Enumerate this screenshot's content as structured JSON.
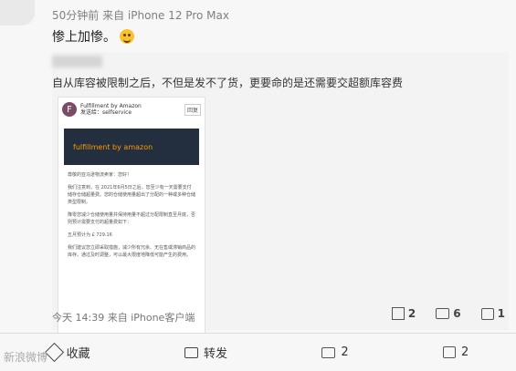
{
  "post_meta": "50分钟前 来自 iPhone 12 Pro Max",
  "comment": "惨上加惨。",
  "quoted_text": "自从库容被限制之后，不但是发不了货，更要命的是还需要交超额库容费",
  "email": {
    "sender_letter": "F",
    "sender_name": "Fulfillment by Amazon",
    "sender_sub": "发送给：selfservice",
    "reply": "回复",
    "banner": "fulfillment by amazon",
    "greeting": "尊敬的亚马逊物流卖家：您好！",
    "p1": "我们注意到，在 2021年6月5日之后，您至少有一天需要支付储存仓储超量费。您的仓储使用量超出了分配的一种或多种仓储类型限制。",
    "p2": "降零您减少仓储使用量并保持用量不超过分配限制直至月底，否则预计需要支付的超量费如下：",
    "p3": "五月预计为 £ 729.16",
    "p4": "我们建议您立即采取措施，减少所有冗余、无在售或滞销商品的库存。通过及时调整，可以最大限度地降低可能产生的费用。"
  },
  "bottom_meta": "今天 14:39 来自 iPhone客户端",
  "mini_actions": {
    "share": "2",
    "comment": "6",
    "like": "1"
  },
  "toolbar": {
    "favorite": "收藏",
    "forward": "转发",
    "comment_count": "2",
    "like_count": "2"
  },
  "watermark": "新浪微博"
}
